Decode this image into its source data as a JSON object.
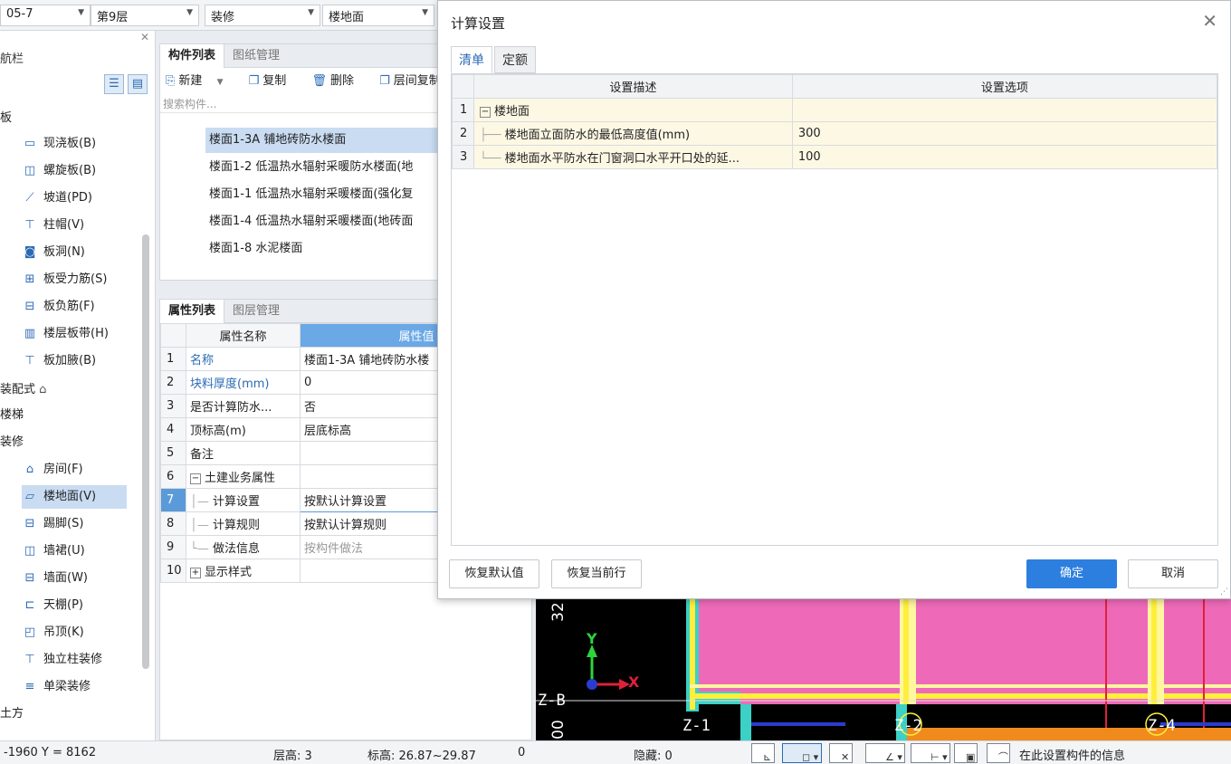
{
  "topbar": {
    "combos": [
      {
        "value": "05-7"
      },
      {
        "value": "第9层"
      },
      {
        "value": "装修"
      },
      {
        "value": "楼地面"
      }
    ]
  },
  "nav": {
    "title": "航栏",
    "sections": {
      "slab": "板",
      "prefab": "装配式",
      "stairs": "楼梯",
      "decor": "装修",
      "earth": "土方"
    },
    "slab_items": [
      {
        "label": "现浇板(B)",
        "icon": "slab-icon"
      },
      {
        "label": "螺旋板(B)",
        "icon": "spiral-slab-icon"
      },
      {
        "label": "坡道(PD)",
        "icon": "ramp-icon"
      },
      {
        "label": "柱帽(V)",
        "icon": "column-cap-icon"
      },
      {
        "label": "板洞(N)",
        "icon": "slab-hole-icon"
      },
      {
        "label": "板受力筋(S)",
        "icon": "slab-rebar-icon"
      },
      {
        "label": "板负筋(F)",
        "icon": "negative-rebar-icon"
      },
      {
        "label": "楼层板带(H)",
        "icon": "slab-strip-icon"
      },
      {
        "label": "板加腋(B)",
        "icon": "haunch-icon"
      }
    ],
    "decor_items": [
      {
        "label": "房间(F)",
        "icon": "room-icon"
      },
      {
        "label": "楼地面(V)",
        "icon": "floor-icon"
      },
      {
        "label": "踢脚(S)",
        "icon": "skirting-icon"
      },
      {
        "label": "墙裙(U)",
        "icon": "dado-icon"
      },
      {
        "label": "墙面(W)",
        "icon": "wall-face-icon"
      },
      {
        "label": "天棚(P)",
        "icon": "ceiling-icon"
      },
      {
        "label": "吊顶(K)",
        "icon": "suspended-ceiling-icon"
      },
      {
        "label": "独立柱装修",
        "icon": "column-finish-icon"
      },
      {
        "label": "单梁装修",
        "icon": "beam-finish-icon"
      }
    ]
  },
  "component_panel": {
    "tabs": [
      "构件列表",
      "图纸管理"
    ],
    "toolbar": {
      "new": "新建",
      "copy": "复制",
      "delete": "删除",
      "floor_copy": "层间复制"
    },
    "search_placeholder": "搜索构件...",
    "items": [
      "楼面1-3A 铺地砖防水楼面",
      "楼面1-2 低温热水辐射采暖防水楼面(地",
      "楼面1-1 低温热水辐射采暖楼面(强化复",
      "楼面1-4 低温热水辐射采暖楼面(地砖面",
      "楼面1-8 水泥楼面"
    ]
  },
  "property_panel": {
    "tabs": [
      "属性列表",
      "图层管理"
    ],
    "headers": {
      "name": "属性名称",
      "value": "属性值"
    },
    "rows": [
      {
        "n": "1",
        "name": "名称",
        "value": "楼面1-3A 铺地砖防水楼"
      },
      {
        "n": "2",
        "name": "块料厚度(mm)",
        "value": "0"
      },
      {
        "n": "3",
        "name": "是否计算防水...",
        "value": "否"
      },
      {
        "n": "4",
        "name": "顶标高(m)",
        "value": "层底标高"
      },
      {
        "n": "5",
        "name": "备注",
        "value": ""
      },
      {
        "n": "6",
        "name": "土建业务属性",
        "value": ""
      },
      {
        "n": "7",
        "name": "计算设置",
        "value": "按默认计算设置"
      },
      {
        "n": "8",
        "name": "计算规则",
        "value": "按默认计算规则"
      },
      {
        "n": "9",
        "name": "做法信息",
        "value": "按构件做法"
      },
      {
        "n": "10",
        "name": "显示样式",
        "value": ""
      }
    ]
  },
  "dialog": {
    "title": "计算设置",
    "tabs": [
      "清单",
      "定额"
    ],
    "headers": {
      "desc": "设置描述",
      "option": "设置选项"
    },
    "rows": [
      {
        "n": "1",
        "desc": "楼地面",
        "option": ""
      },
      {
        "n": "2",
        "desc": "楼地面立面防水的最低高度值(mm)",
        "option": "300"
      },
      {
        "n": "3",
        "desc": "楼地面水平防水在门窗洞口水平开口处的延...",
        "option": "100"
      }
    ],
    "buttons": {
      "restore_default": "恢复默认值",
      "restore_row": "恢复当前行",
      "ok": "确定",
      "cancel": "取消"
    }
  },
  "canvas": {
    "axis_labels": [
      "32",
      "Z-B",
      "00",
      "Z-1",
      "Z-2",
      "Z-4"
    ],
    "axis_y": "Y",
    "axis_x": "X"
  },
  "status": {
    "coords": "-1960 Y = 8162",
    "floor_height": "层高:  3",
    "elevation": "标高:  26.87~29.87",
    "zero": "0",
    "hidden": "隐藏:  0",
    "hint": "在此设置构件的信息"
  },
  "colors": {
    "accent": "#2d7fdf",
    "selection": "#c9dcf2",
    "canvas_pink": "#ee6ab9"
  }
}
